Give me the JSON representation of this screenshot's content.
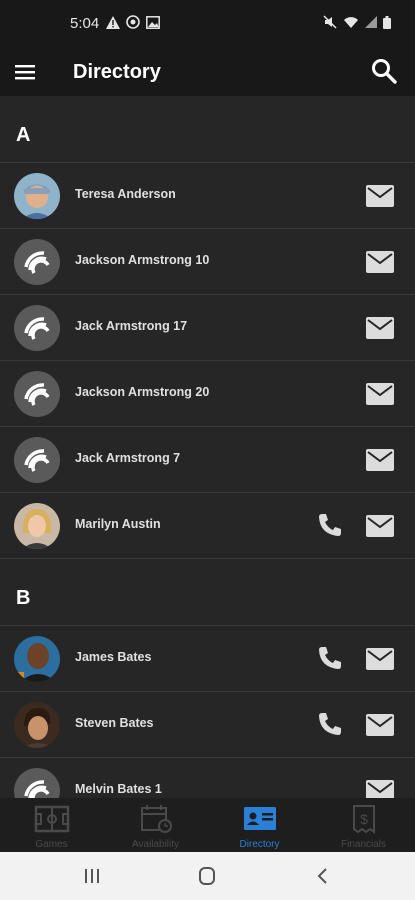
{
  "status_bar": {
    "time": "5:04"
  },
  "app_bar": {
    "title": "Directory"
  },
  "sections": [
    {
      "letter": "A",
      "contacts": [
        {
          "name": "Teresa Anderson",
          "avatar": "photo-man-cap",
          "phone": false
        },
        {
          "name": "Jackson Armstrong 10",
          "avatar": "generic",
          "phone": false
        },
        {
          "name": "Jack Armstrong 17",
          "avatar": "generic",
          "phone": false
        },
        {
          "name": "Jackson Armstrong 20",
          "avatar": "generic",
          "phone": false
        },
        {
          "name": "Jack Armstrong 7",
          "avatar": "generic",
          "phone": false
        },
        {
          "name": "Marilyn Austin",
          "avatar": "photo-woman-blonde",
          "phone": true
        }
      ]
    },
    {
      "letter": "B",
      "contacts": [
        {
          "name": "James Bates",
          "avatar": "photo-man-bald",
          "phone": true
        },
        {
          "name": "Steven Bates",
          "avatar": "photo-man-dark-hair",
          "phone": true
        },
        {
          "name": "Melvin Bates 1",
          "avatar": "generic",
          "phone": false
        }
      ]
    }
  ],
  "bottom_nav": [
    {
      "label": "Games",
      "icon": "field-icon",
      "active": false
    },
    {
      "label": "Availability",
      "icon": "calendar-clock-icon",
      "active": false
    },
    {
      "label": "Directory",
      "icon": "contact-card-icon",
      "active": true
    },
    {
      "label": "Financials",
      "icon": "receipt-dollar-icon",
      "active": false
    }
  ],
  "colors": {
    "background": "#262626",
    "bar": "#181818",
    "accent": "#2a7fd6"
  }
}
